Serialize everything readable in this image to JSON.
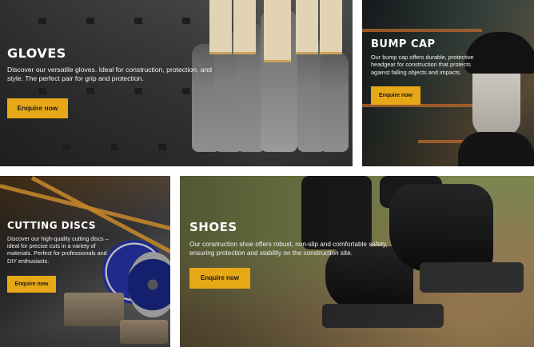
{
  "colors": {
    "accent": "#e6a817",
    "button_text": "#1a1a1a",
    "heading": "#ffffff",
    "background": "#ffffff"
  },
  "tiles": [
    {
      "id": "gloves",
      "title": "GLOVES",
      "description": "Discover our versatile gloves. Ideal for construction, protection, and style. The perfect pair for grip and protection.",
      "button_label": "Enquire now"
    },
    {
      "id": "bump-cap",
      "title": "BUMP CAP",
      "description": "Our bump cap offers durable, protective headgear for construction that protects against falling objects and impacts.",
      "button_label": "Enquire now"
    },
    {
      "id": "cutting-discs",
      "title": "CUTTING DISCS",
      "description": "Discover our high-quality cutting discs – ideal for precise cuts in a variety of materials. Perfect for professionals and DIY enthusiasts.",
      "button_label": "Enquire now"
    },
    {
      "id": "shoes",
      "title": "SHOES",
      "description": "Our construction shoe offers robust, non-slip and comfortable safety, ensuring protection and stability on the construction site.",
      "button_label": "Enquire now"
    }
  ]
}
